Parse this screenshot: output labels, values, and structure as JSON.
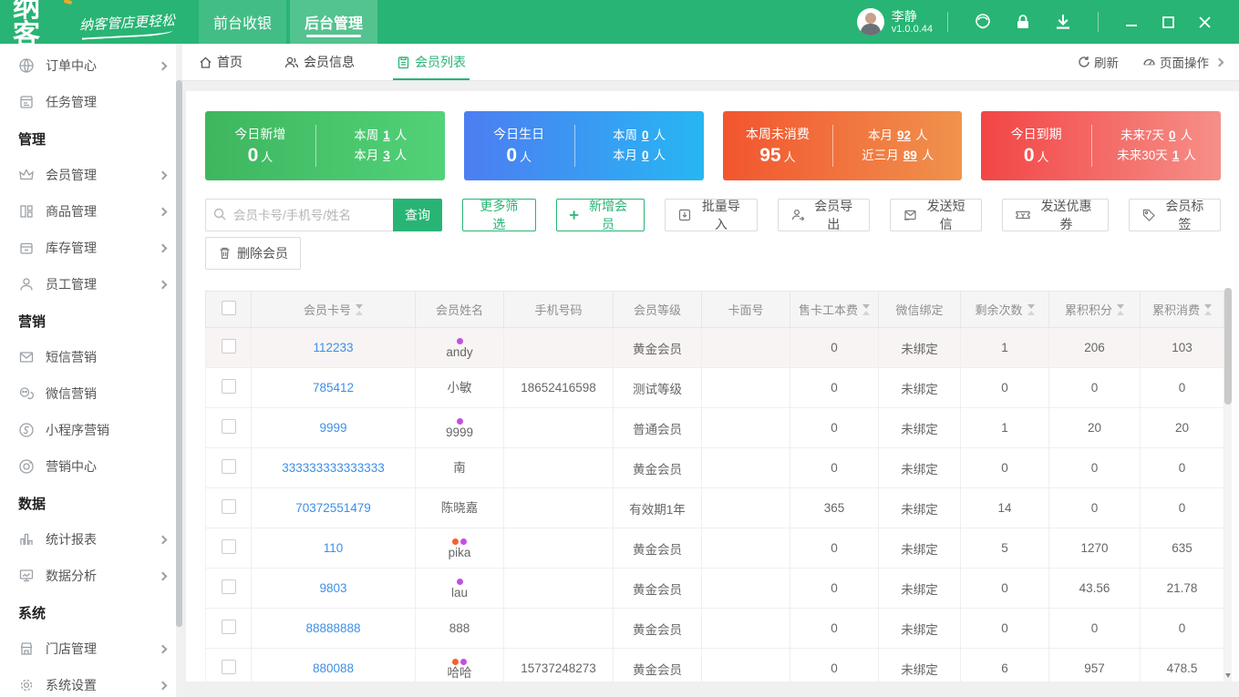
{
  "topbar": {
    "logo": "纳客",
    "tagline": "纳客管店更轻松",
    "nav_tabs": [
      {
        "label": "前台收银",
        "active": false
      },
      {
        "label": "后台管理",
        "active": true
      }
    ],
    "user": {
      "name": "李静",
      "version": "v1.0.0.44"
    },
    "icons": [
      "support-icon",
      "lock-icon",
      "download-icon",
      "minimize-icon",
      "maximize-icon",
      "close-icon"
    ]
  },
  "tabbar": {
    "tabs": [
      {
        "label": "首页",
        "icon": "home-icon",
        "active": false
      },
      {
        "label": "会员信息",
        "icon": "member-icon",
        "active": false
      },
      {
        "label": "会员列表",
        "icon": "list-icon",
        "active": true
      }
    ],
    "actions": [
      {
        "label": "刷新",
        "icon": "refresh-icon"
      },
      {
        "label": "页面操作",
        "icon": "gauge-icon"
      }
    ]
  },
  "sidebar": {
    "items": [
      {
        "type": "item",
        "label": "订单中心",
        "icon": "globe-icon",
        "arrow": true
      },
      {
        "type": "item",
        "label": "任务管理",
        "icon": "tasks-icon",
        "arrow": false
      },
      {
        "type": "section",
        "label": "管理"
      },
      {
        "type": "item",
        "label": "会员管理",
        "icon": "crown-icon",
        "arrow": true
      },
      {
        "type": "item",
        "label": "商品管理",
        "icon": "goods-icon",
        "arrow": true
      },
      {
        "type": "item",
        "label": "库存管理",
        "icon": "inventory-icon",
        "arrow": true
      },
      {
        "type": "item",
        "label": "员工管理",
        "icon": "staff-icon",
        "arrow": true
      },
      {
        "type": "section",
        "label": "营销"
      },
      {
        "type": "item",
        "label": "短信营销",
        "icon": "sms-icon",
        "arrow": false
      },
      {
        "type": "item",
        "label": "微信营销",
        "icon": "wechat-icon",
        "arrow": false
      },
      {
        "type": "item",
        "label": "小程序营销",
        "icon": "miniapp-icon",
        "arrow": false
      },
      {
        "type": "item",
        "label": "营销中心",
        "icon": "target-icon",
        "arrow": false
      },
      {
        "type": "section",
        "label": "数据"
      },
      {
        "type": "item",
        "label": "统计报表",
        "icon": "chart-icon",
        "arrow": true
      },
      {
        "type": "item",
        "label": "数据分析",
        "icon": "analysis-icon",
        "arrow": true
      },
      {
        "type": "section",
        "label": "系统"
      },
      {
        "type": "item",
        "label": "门店管理",
        "icon": "store-icon",
        "arrow": true
      },
      {
        "type": "item",
        "label": "系统设置",
        "icon": "settings-icon",
        "arrow": true
      }
    ]
  },
  "stat_cards": [
    {
      "title": "今日新增",
      "count": "0",
      "unit": "人",
      "color_from": "#3eb65f",
      "color_to": "#52d278",
      "details": [
        {
          "label": "本周",
          "value": "1",
          "unit": "人"
        },
        {
          "label": "本月",
          "value": "3",
          "unit": "人"
        }
      ]
    },
    {
      "title": "今日生日",
      "count": "0",
      "unit": "人",
      "color_from": "#4d7df2",
      "color_to": "#27b6f3",
      "details": [
        {
          "label": "本周",
          "value": "0",
          "unit": "人"
        },
        {
          "label": "本月",
          "value": "0",
          "unit": "人"
        }
      ]
    },
    {
      "title": "本周未消费",
      "count": "95",
      "unit": "人",
      "color_from": "#f2552f",
      "color_to": "#f0924d",
      "details": [
        {
          "label": "本月",
          "value": "92",
          "unit": "人"
        },
        {
          "label": "近三月",
          "value": "89",
          "unit": "人"
        }
      ]
    },
    {
      "title": "今日到期",
      "count": "0",
      "unit": "人",
      "color_from": "#f24545",
      "color_to": "#f68f88",
      "details": [
        {
          "label": "未来7天",
          "value": "0",
          "unit": "人"
        },
        {
          "label": "未来30天",
          "value": "1",
          "unit": "人"
        }
      ]
    }
  ],
  "toolbar": {
    "search_placeholder": "会员卡号/手机号/姓名",
    "query_button": "查询",
    "more_filter_button": "更多筛选",
    "add_member_button": "新增会员",
    "batch_import_button": "批量导入",
    "export_button": "会员导出",
    "send_sms_button": "发送短信",
    "send_coupon_button": "发送优惠券",
    "member_tag_button": "会员标签",
    "delete_member_button": "删除会员"
  },
  "table": {
    "headers": [
      {
        "label": "",
        "sortable": false
      },
      {
        "label": "会员卡号",
        "sortable": true
      },
      {
        "label": "会员姓名",
        "sortable": false
      },
      {
        "label": "手机号码",
        "sortable": false
      },
      {
        "label": "会员等级",
        "sortable": false
      },
      {
        "label": "卡面号",
        "sortable": false
      },
      {
        "label": "售卡工本费",
        "sortable": true
      },
      {
        "label": "微信绑定",
        "sortable": false
      },
      {
        "label": "剩余次数",
        "sortable": true
      },
      {
        "label": "累积积分",
        "sortable": true
      },
      {
        "label": "累积消费",
        "sortable": true
      }
    ],
    "rows": [
      {
        "card_no": "112233",
        "name": "andy",
        "tags": [
          "purple"
        ],
        "phone": "",
        "level": "黄金会员",
        "card_face": "",
        "card_fee": "0",
        "wechat": "未绑定",
        "remain_times": "1",
        "points": "206",
        "consume": "103"
      },
      {
        "card_no": "785412",
        "name": "小敏",
        "tags": [],
        "phone": "18652416598",
        "level": "测试等级",
        "card_face": "",
        "card_fee": "0",
        "wechat": "未绑定",
        "remain_times": "0",
        "points": "0",
        "consume": "0"
      },
      {
        "card_no": "9999",
        "name": "9999",
        "tags": [
          "purple"
        ],
        "phone": "",
        "level": "普通会员",
        "card_face": "",
        "card_fee": "0",
        "wechat": "未绑定",
        "remain_times": "1",
        "points": "20",
        "consume": "20"
      },
      {
        "card_no": "333333333333333",
        "name": "南",
        "tags": [],
        "phone": "",
        "level": "黄金会员",
        "card_face": "",
        "card_fee": "0",
        "wechat": "未绑定",
        "remain_times": "0",
        "points": "0",
        "consume": "0"
      },
      {
        "card_no": "70372551479",
        "name": "陈晓嘉",
        "tags": [],
        "phone": "",
        "level": "有效期1年",
        "card_face": "",
        "card_fee": "365",
        "wechat": "未绑定",
        "remain_times": "14",
        "points": "0",
        "consume": "0"
      },
      {
        "card_no": "110",
        "name": "pika",
        "tags": [
          "orange",
          "purple"
        ],
        "phone": "",
        "level": "黄金会员",
        "card_face": "",
        "card_fee": "0",
        "wechat": "未绑定",
        "remain_times": "5",
        "points": "1270",
        "consume": "635"
      },
      {
        "card_no": "9803",
        "name": "lau",
        "tags": [
          "purple"
        ],
        "phone": "",
        "level": "黄金会员",
        "card_face": "",
        "card_fee": "0",
        "wechat": "未绑定",
        "remain_times": "0",
        "points": "43.56",
        "consume": "21.78"
      },
      {
        "card_no": "88888888",
        "name": "888",
        "tags": [],
        "phone": "",
        "level": "黄金会员",
        "card_face": "",
        "card_fee": "0",
        "wechat": "未绑定",
        "remain_times": "0",
        "points": "0",
        "consume": "0"
      },
      {
        "card_no": "880088",
        "name": "哈哈",
        "tags": [
          "orange",
          "purple"
        ],
        "phone": "15737248273",
        "level": "黄金会员",
        "card_face": "",
        "card_fee": "0",
        "wechat": "未绑定",
        "remain_times": "6",
        "points": "957",
        "consume": "478.5"
      }
    ]
  },
  "colors": {
    "primary_green": "#28b474",
    "link_blue": "#3d8fe8",
    "tag_purple": "#c44fe0",
    "tag_orange": "#f2622f"
  }
}
